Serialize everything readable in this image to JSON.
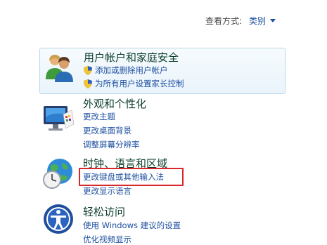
{
  "view_by": {
    "label": "查看方式:",
    "value": "类别"
  },
  "categories": [
    {
      "title": "用户帐户和家庭安全",
      "links": [
        "添加或删除用户帐户",
        "为所有用户设置家长控制"
      ]
    },
    {
      "title": "外观和个性化",
      "links": [
        "更改主题",
        "更改桌面背景",
        "调整屏幕分辨率"
      ]
    },
    {
      "title": "时钟、语言和区域",
      "links": [
        "更改键盘或其他输入法",
        "更改显示语言"
      ]
    },
    {
      "title": "轻松访问",
      "links": [
        "使用 Windows 建议的设置",
        "优化视频显示"
      ]
    }
  ],
  "colors": {
    "link": "#1e4fa0",
    "highlight": "#d8262b",
    "panel_border": "#bcd6ea"
  }
}
